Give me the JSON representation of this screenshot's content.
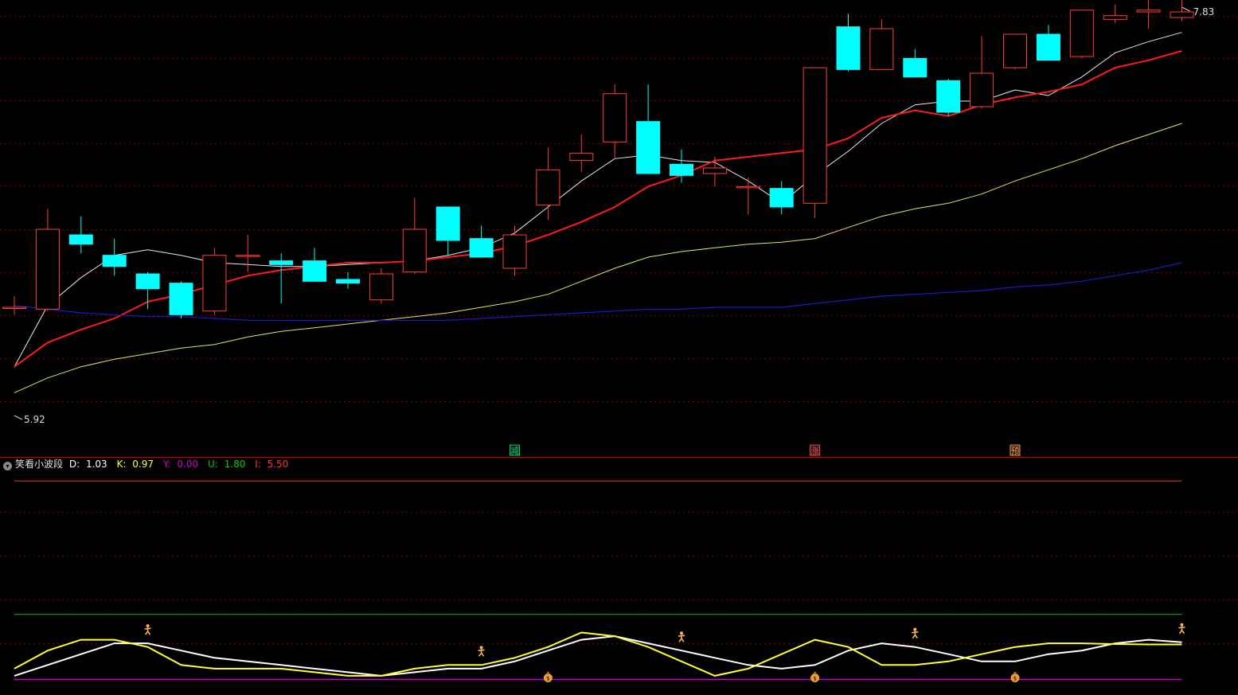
{
  "colors": {
    "background": "#000000",
    "up": "#ff3b3b",
    "down": "#00ffff",
    "grid": "#7a0000",
    "ma5": "#e8e8e8",
    "ma10": "#ff1a1a",
    "ma20": "#e6e65a",
    "ma60": "#1a1acc",
    "ind_d": "#ffffff",
    "ind_k": "#ffff33",
    "ind_y": "#cc00cc",
    "ind_u": "#00cc00",
    "ind_i": "#ff3333"
  },
  "price_pane": {
    "high_label": "7.83",
    "low_label": "5.92"
  },
  "signals": [
    {
      "index": 15,
      "text": "减",
      "color": "#00cc66"
    },
    {
      "index": 24,
      "text": "涨",
      "color": "#ff4444"
    },
    {
      "index": 30,
      "text": "预",
      "color": "#ff9933"
    }
  ],
  "indicator": {
    "name": "笑看小波段",
    "collapse_icon": "chevron-down-icon",
    "fields": [
      {
        "label": "D:",
        "value": "1.03",
        "color": "#ffffff"
      },
      {
        "label": "K:",
        "value": "0.97",
        "color": "#ffff33"
      },
      {
        "label": "Y:",
        "value": "0.00",
        "color": "#cc00cc"
      },
      {
        "label": "U:",
        "value": "1.80",
        "color": "#00cc00"
      },
      {
        "label": "I:",
        "value": "5.50",
        "color": "#ff3333"
      }
    ]
  },
  "chart_data": [
    {
      "type": "candlestick",
      "ylim": [
        5.58,
        7.86
      ],
      "candles": [
        {
          "o": 6.24,
          "c": 6.24,
          "h": 6.3,
          "l": 6.2
        },
        {
          "o": 6.23,
          "c": 6.66,
          "h": 6.77,
          "l": 6.22
        },
        {
          "o": 6.63,
          "c": 6.58,
          "h": 6.73,
          "l": 6.53
        },
        {
          "o": 6.52,
          "c": 6.46,
          "h": 6.61,
          "l": 6.41
        },
        {
          "o": 6.42,
          "c": 6.34,
          "h": 6.43,
          "l": 6.23
        },
        {
          "o": 6.37,
          "c": 6.2,
          "h": 6.38,
          "l": 6.18
        },
        {
          "o": 6.22,
          "c": 6.52,
          "h": 6.56,
          "l": 6.2
        },
        {
          "o": 6.52,
          "c": 6.52,
          "h": 6.63,
          "l": 6.43
        },
        {
          "o": 6.49,
          "c": 6.47,
          "h": 6.53,
          "l": 6.26
        },
        {
          "o": 6.49,
          "c": 6.38,
          "h": 6.56,
          "l": 6.38
        },
        {
          "o": 6.39,
          "c": 6.37,
          "h": 6.43,
          "l": 6.34
        },
        {
          "o": 6.28,
          "c": 6.42,
          "h": 6.45,
          "l": 6.26
        },
        {
          "o": 6.43,
          "c": 6.66,
          "h": 6.83,
          "l": 6.42
        },
        {
          "o": 6.78,
          "c": 6.6,
          "h": 6.78,
          "l": 6.52
        },
        {
          "o": 6.61,
          "c": 6.51,
          "h": 6.68,
          "l": 6.51
        },
        {
          "o": 6.45,
          "c": 6.63,
          "h": 6.68,
          "l": 6.41
        },
        {
          "o": 6.79,
          "c": 6.98,
          "h": 7.1,
          "l": 6.71
        },
        {
          "o": 7.03,
          "c": 7.07,
          "h": 7.17,
          "l": 6.97
        },
        {
          "o": 7.13,
          "c": 7.39,
          "h": 7.44,
          "l": 7.04
        },
        {
          "o": 7.24,
          "c": 6.96,
          "h": 7.44,
          "l": 6.96
        },
        {
          "o": 7.01,
          "c": 6.95,
          "h": 7.09,
          "l": 6.91
        },
        {
          "o": 6.96,
          "c": 6.99,
          "h": 7.05,
          "l": 6.89
        },
        {
          "o": 6.89,
          "c": 6.89,
          "h": 6.94,
          "l": 6.74
        },
        {
          "o": 6.88,
          "c": 6.78,
          "h": 6.92,
          "l": 6.74
        },
        {
          "o": 6.8,
          "c": 7.53,
          "h": 7.53,
          "l": 6.72
        },
        {
          "o": 7.75,
          "c": 7.52,
          "h": 7.82,
          "l": 7.51
        },
        {
          "o": 7.52,
          "c": 7.74,
          "h": 7.79,
          "l": 7.52
        },
        {
          "o": 7.58,
          "c": 7.48,
          "h": 7.63,
          "l": 7.48
        },
        {
          "o": 7.46,
          "c": 7.29,
          "h": 7.47,
          "l": 7.27
        },
        {
          "o": 7.32,
          "c": 7.5,
          "h": 7.7,
          "l": 7.31
        },
        {
          "o": 7.53,
          "c": 7.71,
          "h": 7.71,
          "l": 7.52
        },
        {
          "o": 7.71,
          "c": 7.57,
          "h": 7.76,
          "l": 7.57
        },
        {
          "o": 7.59,
          "c": 7.84,
          "h": 7.84,
          "l": 7.58
        },
        {
          "o": 7.79,
          "c": 7.81,
          "h": 7.87,
          "l": 7.77
        },
        {
          "o": 7.83,
          "c": 7.84,
          "h": 7.9,
          "l": 7.74
        },
        {
          "o": 7.8,
          "c": 7.83,
          "h": 7.93,
          "l": 7.78
        }
      ],
      "series": [
        {
          "values": [
            5.92,
            6.25,
            6.4,
            6.52,
            6.55,
            6.52,
            6.48,
            6.47,
            6.46,
            6.46,
            6.47,
            6.48,
            6.49,
            6.52,
            6.56,
            6.64,
            6.78,
            6.92,
            7.04,
            7.06,
            7.03,
            7.02,
            6.92,
            6.8,
            6.95,
            7.08,
            7.23,
            7.33,
            7.35,
            7.35,
            7.41,
            7.38,
            7.48,
            7.61,
            7.67,
            7.72
          ]
        },
        {
          "values": [
            5.92,
            6.05,
            6.12,
            6.18,
            6.27,
            6.31,
            6.36,
            6.41,
            6.44,
            6.46,
            6.48,
            6.48,
            6.49,
            6.51,
            6.53,
            6.57,
            6.63,
            6.7,
            6.78,
            6.89,
            6.95,
            7.03,
            7.05,
            7.07,
            7.09,
            7.15,
            7.26,
            7.3,
            7.27,
            7.33,
            7.37,
            7.4,
            7.44,
            7.53,
            7.57,
            7.62
          ]
        },
        {
          "values": [
            5.78,
            5.86,
            5.92,
            5.96,
            5.99,
            6.02,
            6.04,
            6.08,
            6.11,
            6.13,
            6.15,
            6.17,
            6.19,
            6.21,
            6.24,
            6.27,
            6.31,
            6.38,
            6.45,
            6.51,
            6.54,
            6.56,
            6.58,
            6.59,
            6.61,
            6.67,
            6.73,
            6.77,
            6.8,
            6.85,
            6.92,
            6.98,
            7.04,
            7.11,
            7.17,
            7.23
          ]
        },
        {
          "values": [
            6.25,
            6.23,
            6.21,
            6.2,
            6.19,
            6.19,
            6.18,
            6.17,
            6.17,
            6.17,
            6.17,
            6.17,
            6.17,
            6.17,
            6.18,
            6.19,
            6.2,
            6.21,
            6.22,
            6.23,
            6.23,
            6.24,
            6.24,
            6.24,
            6.26,
            6.28,
            6.3,
            6.31,
            6.32,
            6.33,
            6.35,
            6.36,
            6.38,
            6.41,
            6.44,
            6.48
          ]
        }
      ]
    },
    {
      "type": "line",
      "ylim": [
        -0.1,
        5.7
      ],
      "series": [
        {
          "name": "D",
          "values": [
            0.1,
            0.4,
            0.7,
            1.0,
            1.0,
            0.8,
            0.6,
            0.5,
            0.4,
            0.3,
            0.2,
            0.1,
            0.2,
            0.3,
            0.3,
            0.5,
            0.8,
            1.1,
            1.2,
            1.0,
            0.8,
            0.6,
            0.4,
            0.3,
            0.4,
            0.8,
            1.0,
            0.9,
            0.7,
            0.5,
            0.5,
            0.7,
            0.8,
            1.0,
            1.1,
            1.03
          ]
        },
        {
          "name": "K",
          "values": [
            0.3,
            0.8,
            1.1,
            1.1,
            0.9,
            0.4,
            0.3,
            0.3,
            0.3,
            0.2,
            0.1,
            0.1,
            0.3,
            0.4,
            0.4,
            0.6,
            0.9,
            1.3,
            1.2,
            0.9,
            0.5,
            0.1,
            0.3,
            0.7,
            1.1,
            0.9,
            0.4,
            0.4,
            0.5,
            0.7,
            0.9,
            1.0,
            1.0,
            0.98,
            0.97,
            0.97
          ]
        },
        {
          "name": "Y",
          "values": [
            0.0,
            0.0,
            0.0,
            0.0,
            0.0,
            0.0,
            0.0,
            0.0,
            0.0,
            0.0,
            0.0,
            0.0,
            0.0,
            0.0,
            0.0,
            0.0,
            0.0,
            0.0,
            0.0,
            0.0,
            0.0,
            0.0,
            0.0,
            0.0,
            0.0,
            0.0,
            0.0,
            0.0,
            0.0,
            0.0,
            0.0,
            0.0,
            0.0,
            0.0,
            0.0,
            0.0
          ]
        },
        {
          "name": "U",
          "values": [
            1.8,
            1.8,
            1.8,
            1.8,
            1.8,
            1.8,
            1.8,
            1.8,
            1.8,
            1.8,
            1.8,
            1.8,
            1.8,
            1.8,
            1.8,
            1.8,
            1.8,
            1.8,
            1.8,
            1.8,
            1.8,
            1.8,
            1.8,
            1.8,
            1.8,
            1.8,
            1.8,
            1.8,
            1.8,
            1.8,
            1.8,
            1.8,
            1.8,
            1.8,
            1.8,
            1.8
          ]
        },
        {
          "name": "I",
          "values": [
            5.5,
            5.5,
            5.5,
            5.5,
            5.5,
            5.5,
            5.5,
            5.5,
            5.5,
            5.5,
            5.5,
            5.5,
            5.5,
            5.5,
            5.5,
            5.5,
            5.5,
            5.5,
            5.5,
            5.5,
            5.5,
            5.5,
            5.5,
            5.5,
            5.5,
            5.5,
            5.5,
            5.5,
            5.5,
            5.5,
            5.5,
            5.5,
            5.5,
            5.5,
            5.5,
            5.5
          ]
        }
      ],
      "markers": [
        {
          "index": 4,
          "kind": "person"
        },
        {
          "index": 14,
          "kind": "person"
        },
        {
          "index": 20,
          "kind": "person"
        },
        {
          "index": 27,
          "kind": "person"
        },
        {
          "index": 35,
          "kind": "person"
        },
        {
          "index": 16,
          "kind": "money-bag"
        },
        {
          "index": 30,
          "kind": "money-bag"
        },
        {
          "index": 24,
          "kind": "money-bag"
        }
      ]
    }
  ]
}
